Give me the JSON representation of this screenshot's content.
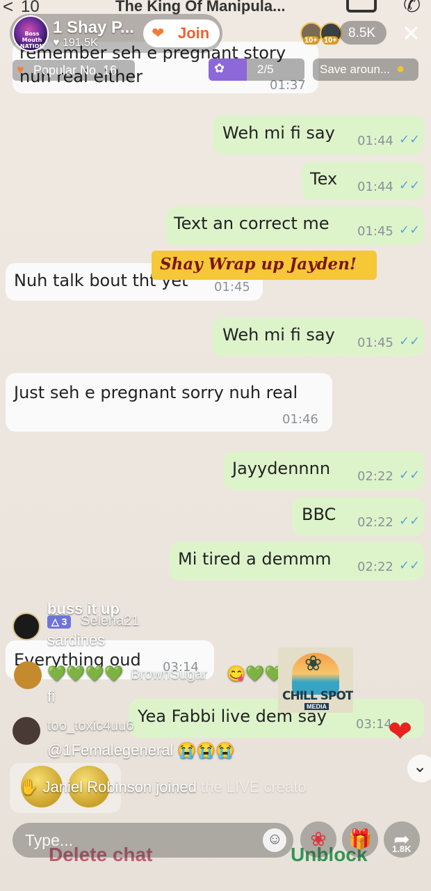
{
  "background_chat": {
    "header": {
      "count": "10",
      "name": "The King Of Manipula..."
    },
    "messages": [
      {
        "dir": "in",
        "text": "remember seh e pregnant story",
        "text2": "nuh real either",
        "time": "01:37"
      },
      {
        "dir": "out",
        "text": "Weh mi fi say",
        "time": "01:44"
      },
      {
        "dir": "out",
        "text": "Tex",
        "time": "01:44"
      },
      {
        "dir": "out",
        "text": "Text an correct me",
        "time": "01:45"
      },
      {
        "dir": "in",
        "text": "Nuh talk bout tht yet",
        "time": "01:45"
      },
      {
        "dir": "out",
        "text": "Weh mi fi say",
        "time": "01:45"
      },
      {
        "dir": "in",
        "text": "Just seh e pregnant sorry nuh real",
        "time": "01:46"
      },
      {
        "dir": "out",
        "text": "Jayydennnn",
        "time": "02:22"
      },
      {
        "dir": "out",
        "text": "BBC",
        "time": "02:22"
      },
      {
        "dir": "out",
        "text": "Mi tired a demmm",
        "time": "02:22"
      },
      {
        "dir": "in",
        "text": "Everything oud",
        "time": "03:14"
      },
      {
        "dir": "out",
        "text": "Yea Fabbi live dem say",
        "time": "03:14"
      }
    ],
    "delete_chat": "Delete chat",
    "unblock": "Unblock"
  },
  "live": {
    "host": {
      "name": "1 Shay P...",
      "likes": "191.5K",
      "avatar_text": "Boss Mouth NATION"
    },
    "join_label": "Join",
    "viewers": [
      {
        "badge": "10+"
      },
      {
        "badge": "10+"
      }
    ],
    "viewer_count": "8.5K",
    "popular": "Popular No. 16",
    "goal": {
      "progress": "2/5",
      "fraction": 0.4
    },
    "save_around": "Save aroun...",
    "banner": "Shay Wrap up Jayden!",
    "comments": {
      "c1_text": "buss it up",
      "c1_level": "3",
      "c1_user": "Selena21",
      "c1_msg": "sardines",
      "c2_msg": "💚💚💚💚",
      "c2_user": "BrownSugar",
      "c2_msg2": "😋💚💚",
      "c2_msg3": "fi",
      "c3_user": "too_toxic4uu6",
      "c3_msg": "@1Femalegeneral 😭😭😭",
      "joined": "Janiel Robinson joined",
      "joined_tail": "the LIVE creato"
    },
    "chill_spot": {
      "line1": "CHILL SPOT",
      "line2": "MEDIA"
    },
    "input_placeholder": "Type...",
    "share_count": "1.8K"
  },
  "colors": {
    "bubble_out": "#ddf4cb",
    "bubble_in": "#fafafa",
    "banner": "#f6c736",
    "join": "#f0602d"
  }
}
